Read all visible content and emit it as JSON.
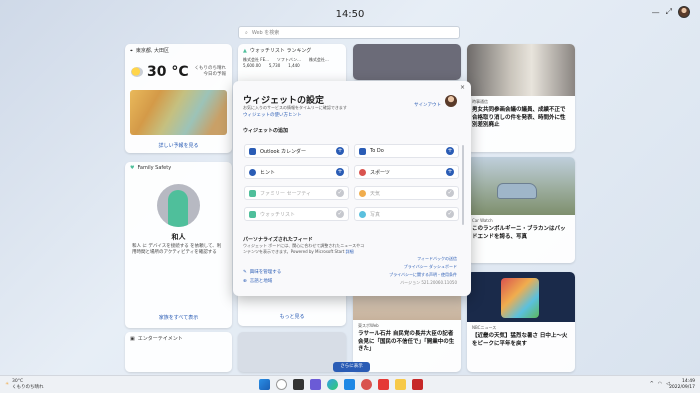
{
  "desktop": {
    "clock": "14:50"
  },
  "search": {
    "placeholder": "Web を検索"
  },
  "weather": {
    "header": "東京都, 大田区",
    "temp": "30 °C",
    "desc_line1": "くもりのち晴れ",
    "desc_line2": "今日の予報",
    "footer": "詳しい予報を見る"
  },
  "stocks": {
    "header": "ウォッチリスト ランキング",
    "rows": [
      [
        "株式会社 FE...",
        "ソフトバン...",
        "株式会社..."
      ],
      [
        "5,600.00",
        "5,730",
        "1,440"
      ]
    ]
  },
  "family": {
    "header": "Family Safety",
    "name": "和人",
    "message": "和人 に デバイスを接続する を依頼して、利用時間と場所のアクティビティを確認する",
    "footer": "家族をすべて表示"
  },
  "entertainment": {
    "header": "エンターテイメント"
  },
  "news": {
    "r1": {
      "source": "時事通信",
      "title": "男女共同参画会議の議員、成績不正で合格取り消しの件を発表、時間外に性別差別廃止"
    },
    "r2": {
      "source": "Car Watch",
      "title": "このランボルギーニ・ブラカンはパッドエンドを誇る、写真"
    },
    "r3": {
      "source": "NBCニュース",
      "title": "【近畿の天気】猛烈な暑さ 日中上〜火をピークに平年を戻す"
    },
    "m": {
      "source": "東スポWeb",
      "title": "ラサール石井 自民党の長井大臣の記者会見に「国民の不信任で」「開業中の生きた」"
    },
    "more_button": "さらに表示",
    "grid_label": "もっと見る"
  },
  "dialog": {
    "title": "ウィジェットの設定",
    "subtitle": "お気に入りのサービスの情報をタイムリーに確認できます",
    "help_link": "ウィジェットの使い方ヒント",
    "account": "",
    "signout": "サインアウト",
    "close": "×",
    "add_section": "ウィジェットの追加",
    "widgets": [
      {
        "label": "Outlook カレンダー",
        "icon": "calendar-icon",
        "color": "#2a5cb5",
        "enabled": true
      },
      {
        "label": "To Do",
        "icon": "check-icon",
        "color": "#2a5cb5",
        "enabled": true
      },
      {
        "label": "ヒント",
        "icon": "bulb-icon",
        "color": "#2a5cb5",
        "enabled": true
      },
      {
        "label": "スポーツ",
        "icon": "ball-icon",
        "color": "#d9534f",
        "enabled": true
      },
      {
        "label": "ファミリー セーフティ",
        "icon": "heart-icon",
        "color": "#4fbf9b",
        "enabled": false
      },
      {
        "label": "天気",
        "icon": "sun-icon",
        "color": "#f0ad4e",
        "enabled": false
      },
      {
        "label": "ウォッチリスト",
        "icon": "chart-icon",
        "color": "#4fbf9b",
        "enabled": false
      },
      {
        "label": "写真",
        "icon": "cloud-icon",
        "color": "#5bc0de",
        "enabled": false
      }
    ],
    "personalize_section": "パーソナライズされたフィード",
    "personalize_desc": "ウィジェット ボードには、関心に合わせて調整されたニュースやコンテンツを表示できます。Powered by Microsoft Start",
    "detail_link": "詳細",
    "interest_link": "興味を管理する",
    "lang_link": "言語と地域",
    "feedback_link": "フィードバックの送信",
    "privacy_dashboard": "プライバシー ダッシュボード",
    "privacy_terms": "プライバシーに関する声明・使用条件",
    "version": "バージョン 521.20060.11050"
  },
  "taskbar": {
    "weather_temp": "30°C",
    "weather_desc": "くもりのち晴れ",
    "time": "14:49",
    "date": "2022/09/17"
  }
}
